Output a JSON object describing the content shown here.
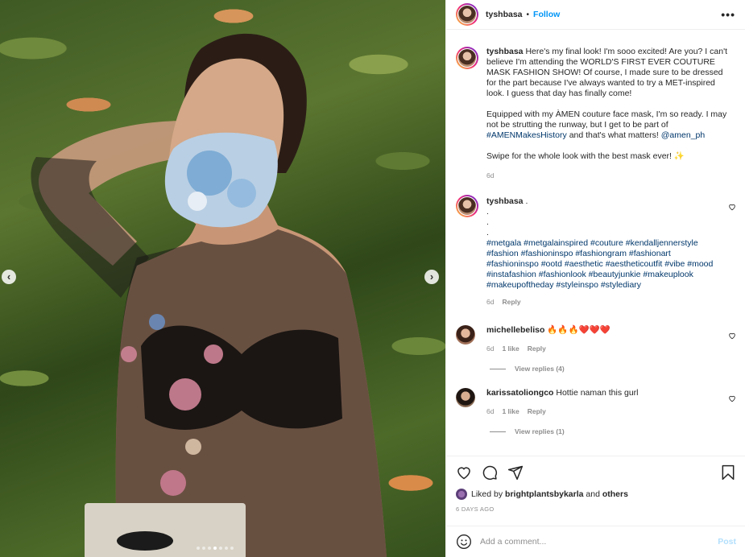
{
  "post": {
    "username": "tyshbasa",
    "separator": "•",
    "follow_label": "Follow",
    "more_label": "•••",
    "image_alt": "Woman wearing a blue floral couture face mask and sheer embroidered top",
    "carousel": {
      "slides": 7,
      "active_index": 3
    }
  },
  "caption": {
    "username": "tyshbasa",
    "paragraphs": [
      "Here's my final look! I'm sooo excited! Are you? I can't believe I'm attending the WORLD'S FIRST EVER COUTURE MASK FASHION SHOW! Of course, I made sure to be dressed for the part because I've always wanted to try a MET-inspired look. I guess that day has finally come!",
      "Equipped with my ÀMEN couture face mask, I'm so ready. I may not be strutting the runway, but I get to be part of",
      "Swipe for the whole look with the best mask ever! ✨"
    ],
    "hashtag": "#AMENMakesHistory",
    "p2_mid": " and that's what matters! ",
    "mention": "@amen_ph",
    "time": "6d"
  },
  "comments": [
    {
      "username": "tyshbasa",
      "text": ".",
      "dots": [
        ".",
        ".",
        "."
      ],
      "hashtags": "#metgala #metgalainspired #couture #kendalljennerstyle #fashion #fashioninspo #fashiongram #fashionart #fashioninspo #ootd #aesthetic #aestheticoutfit #vibe #mood #instafashion #fashionlook #beautyjunkie #makeuplook #makeupoftheday #styleinspo #stylediary",
      "time": "6d",
      "reply": "Reply"
    },
    {
      "username": "michellebeliso",
      "text": "🔥🔥🔥❤️❤️❤️",
      "time": "6d",
      "likes": "1 like",
      "reply": "Reply",
      "view_replies": "View replies (4)"
    },
    {
      "username": "karissatoliongco",
      "text": "Hottie naman this gurl",
      "time": "6d",
      "likes": "1 like",
      "reply": "Reply",
      "view_replies": "View replies (1)"
    }
  ],
  "likes": {
    "prefix": "Liked by ",
    "user": "brightplantsbykarla",
    "mid": " and ",
    "others": "others",
    "time": "6 DAYS AGO"
  },
  "add_comment": {
    "placeholder": "Add a comment...",
    "post_label": "Post"
  },
  "colors": {
    "link": "#00376b",
    "follow": "#0095f6",
    "post_disabled": "#b2dffc",
    "muted": "#8e8e8e"
  }
}
